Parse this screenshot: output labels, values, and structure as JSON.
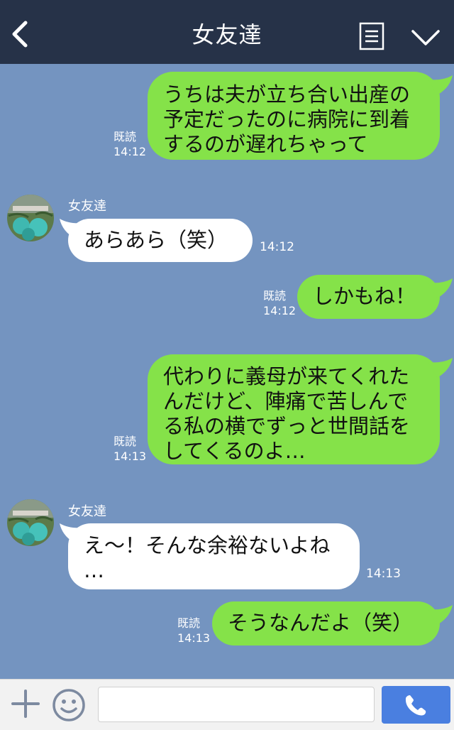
{
  "header": {
    "title": "女友達",
    "back_icon": "chevron-left-icon",
    "menu_icon": "note-menu-icon",
    "dropdown_icon": "chevron-down-icon",
    "bg_color": "#263248"
  },
  "chat": {
    "bg_color": "#7494c0",
    "messages": [
      {
        "direction": "out",
        "lines": [
          "うちは夫が立ち合い出産の",
          "予定だったのに病院に到着",
          "するのが遅れちゃって"
        ],
        "read": "既読",
        "time": "14:12"
      },
      {
        "direction": "in",
        "sender": "女友達",
        "lines": [
          "あらあら（笑）"
        ],
        "time": "14:12"
      },
      {
        "direction": "out",
        "lines": [
          "しかもね！"
        ],
        "read": "既読",
        "time": "14:12"
      },
      {
        "direction": "out",
        "lines": [
          "代わりに義母が来てくれた",
          "んだけど、陣痛で苦しんで",
          "る私の横でずっと世間話を",
          "してくるのよ…"
        ],
        "read": "既読",
        "time": "14:13"
      },
      {
        "direction": "in",
        "sender": "女友達",
        "lines": [
          "え〜！そんな余裕ないよね",
          "…"
        ],
        "time": "14:13"
      },
      {
        "direction": "out",
        "lines": [
          "そうなんだよ（笑）"
        ],
        "read": "既読",
        "time": "14:13"
      }
    ]
  },
  "footer": {
    "plus_icon": "plus-icon",
    "sticker_icon": "smiley-icon",
    "input_value": "",
    "call_icon": "phone-icon",
    "call_color": "#4a7fe0"
  },
  "colors": {
    "outgoing_bubble": "#85e249",
    "incoming_bubble": "#ffffff"
  }
}
